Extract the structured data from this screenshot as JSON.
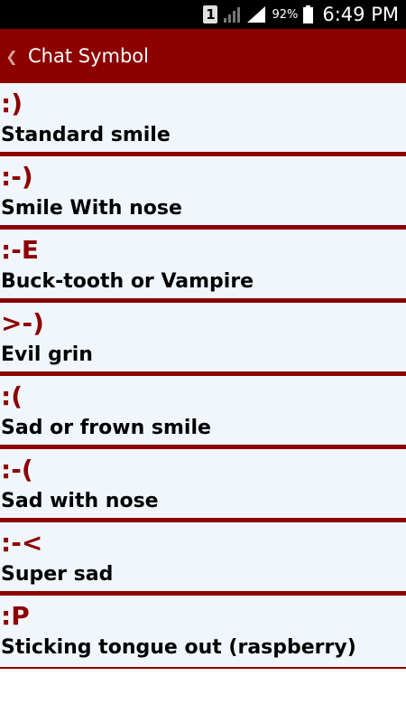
{
  "status_bar": {
    "sim": "1",
    "battery": "92%",
    "time": "6:49 PM"
  },
  "app_bar": {
    "back_icon": "chevron-left-icon",
    "title": "Chat Symbol"
  },
  "colors": {
    "primary": "#8c0000",
    "item_background": "#f1f6fc"
  },
  "items": [
    {
      "symbol": ":)",
      "meaning": "Standard smile"
    },
    {
      "symbol": ":-)",
      "meaning": "Smile With nose"
    },
    {
      "symbol": ":-E",
      "meaning": "Buck-tooth or Vampire"
    },
    {
      "symbol": ">-)",
      "meaning": "Evil grin"
    },
    {
      "symbol": ":(",
      "meaning": "Sad or frown smile"
    },
    {
      "symbol": ":-(",
      "meaning": "Sad with nose"
    },
    {
      "symbol": ":-<",
      "meaning": "Super sad"
    },
    {
      "symbol": ":P",
      "meaning": "Sticking tongue out (raspberry)"
    }
  ]
}
